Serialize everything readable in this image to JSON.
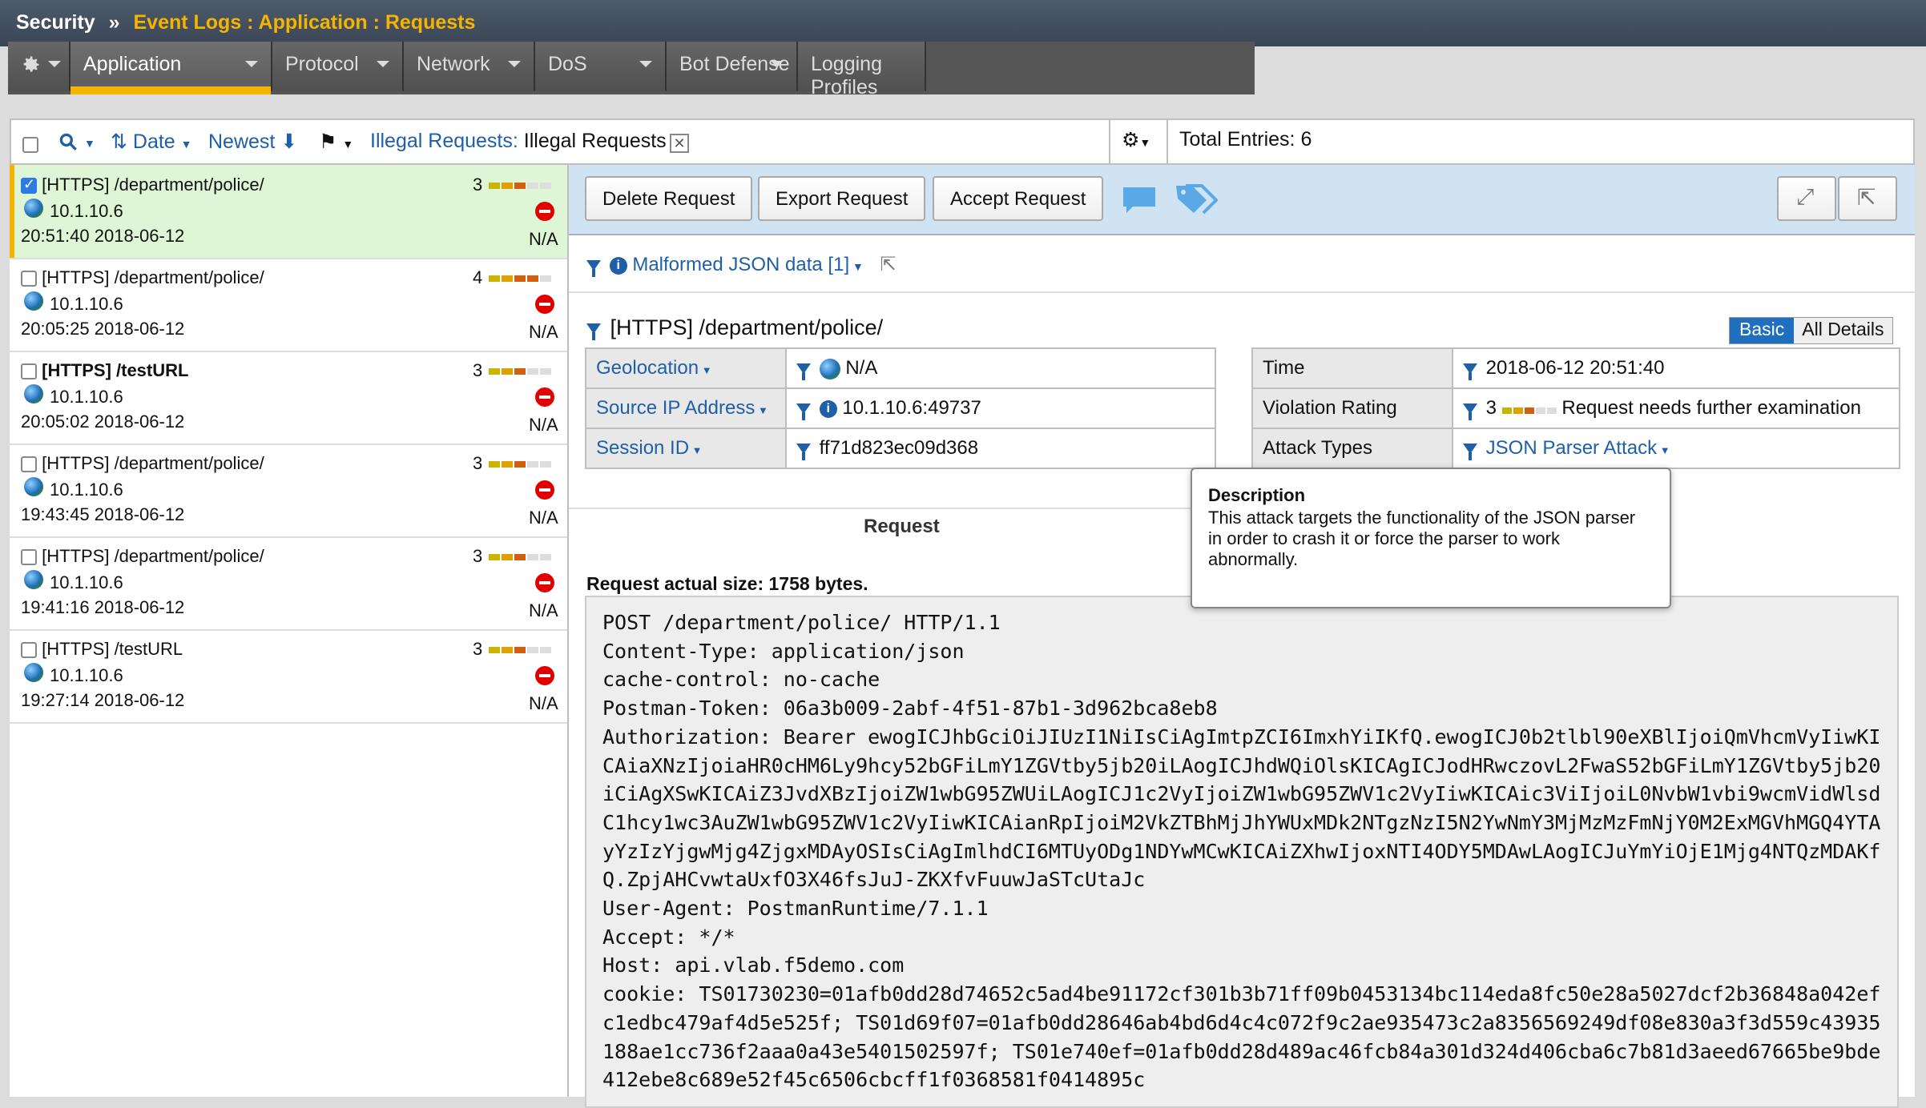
{
  "breadcrumb": {
    "root": "Security",
    "sep": "»",
    "path": "Event Logs : Application : Requests"
  },
  "tabs": [
    {
      "label": "Application"
    },
    {
      "label": "Protocol"
    },
    {
      "label": "Network"
    },
    {
      "label": "DoS"
    },
    {
      "label": "Bot Defense"
    },
    {
      "label": "Logging Profiles"
    }
  ],
  "toolbar": {
    "sort_label": "Date",
    "order_label": "Newest",
    "filter_key": "Illegal Requests:",
    "filter_value": "Illegal Requests",
    "total": "Total Entries: 6"
  },
  "list": [
    {
      "title": "[HTTPS] /department/police/",
      "ip": "10.1.10.6",
      "time": "20:51:40 2018-06-12",
      "rating": "3",
      "geo": "N/A"
    },
    {
      "title": "[HTTPS] /department/police/",
      "ip": "10.1.10.6",
      "time": "20:05:25 2018-06-12",
      "rating": "4",
      "geo": "N/A"
    },
    {
      "title": "[HTTPS] /testURL",
      "ip": "10.1.10.6",
      "time": "20:05:02 2018-06-12",
      "rating": "3",
      "geo": "N/A"
    },
    {
      "title": "[HTTPS] /department/police/",
      "ip": "10.1.10.6",
      "time": "19:43:45 2018-06-12",
      "rating": "3",
      "geo": "N/A"
    },
    {
      "title": "[HTTPS] /department/police/",
      "ip": "10.1.10.6",
      "time": "19:41:16 2018-06-12",
      "rating": "3",
      "geo": "N/A"
    },
    {
      "title": "[HTTPS] /testURL",
      "ip": "10.1.10.6",
      "time": "19:27:14 2018-06-12",
      "rating": "3",
      "geo": "N/A"
    }
  ],
  "actions": {
    "delete": "Delete Request",
    "export": "Export Request",
    "accept": "Accept Request"
  },
  "detail": {
    "violation": "Malformed JSON data [1]",
    "title": "[HTTPS] /department/police/",
    "view_basic": "Basic",
    "view_all": "All Details",
    "left": {
      "geo_label": "Geolocation",
      "geo_value": "N/A",
      "ip_label": "Source IP Address",
      "ip_value": "10.1.10.6:49737",
      "session_label": "Session ID",
      "session_value": "ff71d823ec09d368"
    },
    "right": {
      "time_label": "Time",
      "time_value": "2018-06-12 20:51:40",
      "rating_label": "Violation Rating",
      "rating_value": "3",
      "rating_text": "Request needs further examination",
      "attack_label": "Attack Types",
      "attack_value": "JSON Parser Attack"
    },
    "tooltip": {
      "title": "Description",
      "text": "This attack targets the functionality of the JSON parser in order to crash it or force the parser to work abnormally."
    },
    "request_tab": "Request",
    "size": "Request actual size: 1758 bytes.",
    "raw": "POST /department/police/ HTTP/1.1\nContent-Type: application/json\ncache-control: no-cache\nPostman-Token: 06a3b009-2abf-4f51-87b1-3d962bca8eb8\nAuthorization: Bearer ewogICJhbGciOiJIUzI1NiIsCiAgImtpZCI6ImxhYiIKfQ.ewogICJ0b2tlbl90eXBlIjoiQmVhcmVyIiwKICAiaXNzIjoiaHR0cHM6Ly9hcy52bGFiLmY1ZGVtby5jb20iLAogICJhdWQiOlsKICAgICJodHRwczovL2FwaS52bGFiLmY1ZGVtby5jb20iCiAgXSwKICAiZ3JvdXBzIjoiZW1wbG95ZWUiLAogICJ1c2VyIjoiZW1wbG95ZWV1c2VyIiwKICAic3ViIjoiL0NvbW1vbi9wcmVidWlsdC1hcy1wc3AuZW1wbG95ZWV1c2VyIiwKICAianRpIjoiM2VkZTBhMjJhYWUxMDk2NTgzNzI5N2YwNmY3MjMzMzFmNjY0M2ExMGVhMGQ4YTAyYzIzYjgwMjg4ZjgxMDAyOSIsCiAgImlhdCI6MTUyODg1NDYwMCwKICAiZXhwIjoxNTI4ODY5MDAwLAogICJuYmYiOjE1Mjg4NTQzMDAKfQ.ZpjAHCvwtaUxfO3X46fsJuJ-ZKXfvFuuwJaSTcUtaJc\nUser-Agent: PostmanRuntime/7.1.1\nAccept: */*\nHost: api.vlab.f5demo.com\ncookie: TS01730230=01afb0dd28d74652c5ad4be91172cf301b3b71ff09b0453134bc114eda8fc50e28a5027dcf2b36848a042efc1edbc479af4d5e525f; TS01d69f07=01afb0dd28646ab4bd6d4c4c072f9c2ae935473c2a8356569249df08e830a3f3d559c43935188ae1cc736f2aaa0a43e5401502597f; TS01e740ef=01afb0dd28d489ac46fcb84a301d324d406cba6c7b81d3aeed67665be9bde412ebe8c689e52f45c6506cbcff1f0368581f0414895c"
  },
  "colors": {
    "accent": "#f4b400",
    "link": "#1f5fa8",
    "selected_row": "#dff6d6",
    "action_bar": "#cfe3f3"
  }
}
